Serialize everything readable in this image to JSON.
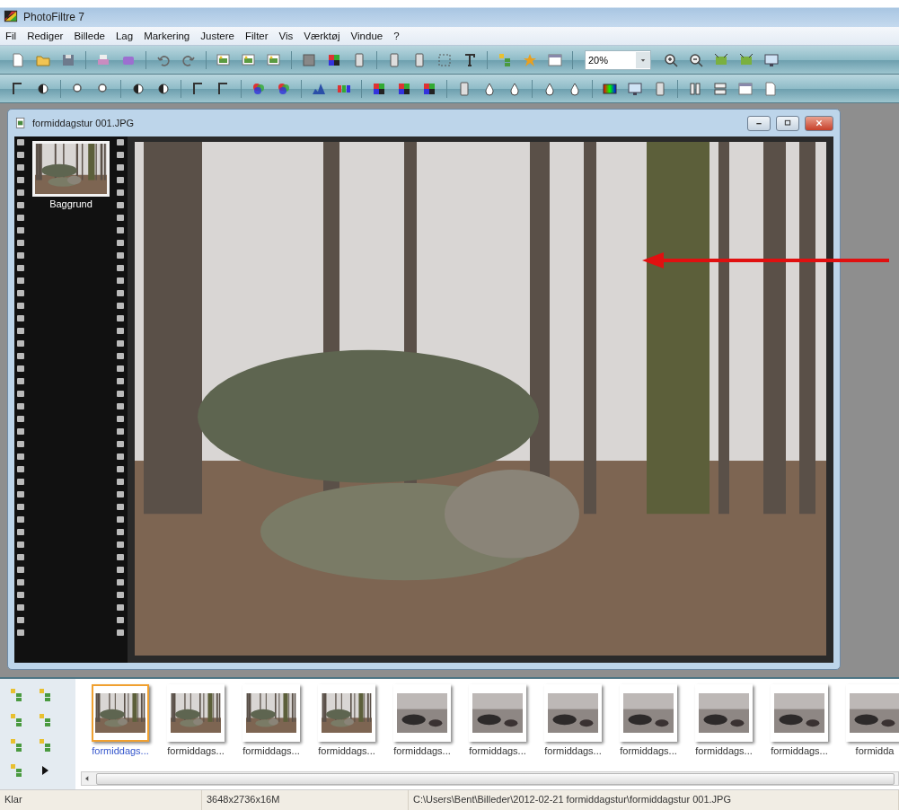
{
  "app": {
    "title": "PhotoFiltre 7"
  },
  "menu": [
    "Fil",
    "Rediger",
    "Billede",
    "Lag",
    "Markering",
    "Justere",
    "Filter",
    "Vis",
    "Værktøj",
    "Vindue",
    "?"
  ],
  "toolbar": {
    "zoom": "20%"
  },
  "document": {
    "title": "formiddagstur 001.JPG",
    "layers": [
      {
        "name": "Baggrund",
        "selected": true
      }
    ]
  },
  "thumbnails": [
    {
      "label": "formiddags...",
      "kind": "forest",
      "selected": true
    },
    {
      "label": "formiddags...",
      "kind": "forest",
      "selected": false
    },
    {
      "label": "formiddags...",
      "kind": "forest",
      "selected": false
    },
    {
      "label": "formiddags...",
      "kind": "forest",
      "selected": false
    },
    {
      "label": "formiddags...",
      "kind": "sea",
      "selected": false
    },
    {
      "label": "formiddags...",
      "kind": "sea",
      "selected": false
    },
    {
      "label": "formiddags...",
      "kind": "sea",
      "selected": false
    },
    {
      "label": "formiddags...",
      "kind": "sea",
      "selected": false
    },
    {
      "label": "formiddags...",
      "kind": "sea",
      "selected": false
    },
    {
      "label": "formiddags...",
      "kind": "sea",
      "selected": false
    },
    {
      "label": "formidda",
      "kind": "sea",
      "selected": false
    }
  ],
  "status_bar": {
    "state": "Klar",
    "dimensions": "3648x2736x16M",
    "path": "C:\\Users\\Bent\\Billeder\\2012-02-21 formiddagstur\\formiddagstur 001.JPG"
  }
}
